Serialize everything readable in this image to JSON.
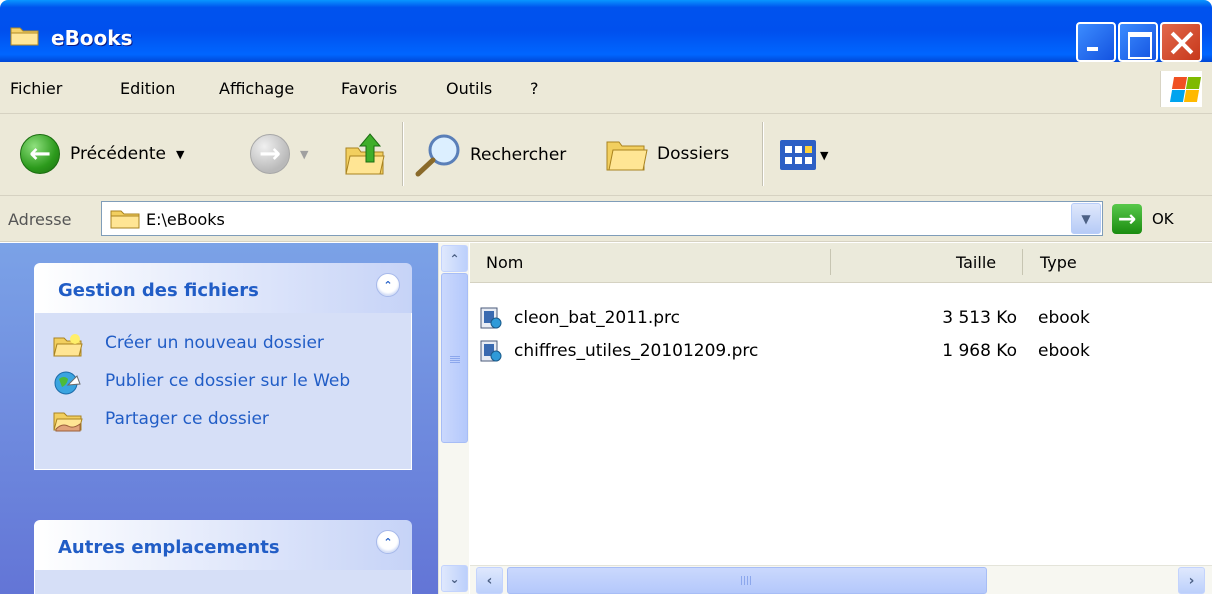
{
  "window": {
    "title": "eBooks",
    "accent": "#0055ea"
  },
  "menu": {
    "items": [
      "Fichier",
      "Edition",
      "Affichage",
      "Favoris",
      "Outils",
      "?"
    ]
  },
  "toolbar": {
    "back_label": "Précédente",
    "search_label": "Rechercher",
    "folders_label": "Dossiers"
  },
  "address": {
    "label": "Adresse",
    "value": "E:\\eBooks",
    "go_label": "OK"
  },
  "taskpane": {
    "file_tasks": {
      "title": "Gestion des fichiers",
      "links": [
        {
          "label": "Créer un nouveau dossier",
          "icon": "new-folder-icon"
        },
        {
          "label": "Publier ce dossier sur le Web",
          "icon": "publish-web-icon"
        },
        {
          "label": "Partager ce dossier",
          "icon": "share-folder-icon"
        }
      ]
    },
    "other_places": {
      "title": "Autres emplacements"
    }
  },
  "filelist": {
    "columns": {
      "name": "Nom",
      "size": "Taille",
      "type": "Type"
    },
    "files": [
      {
        "name": "cleon_bat_2011.prc",
        "size": "3 513 Ko",
        "type": "ebook"
      },
      {
        "name": "chiffres_utiles_20101209.prc",
        "size": "1 968 Ko",
        "type": "ebook"
      }
    ]
  }
}
